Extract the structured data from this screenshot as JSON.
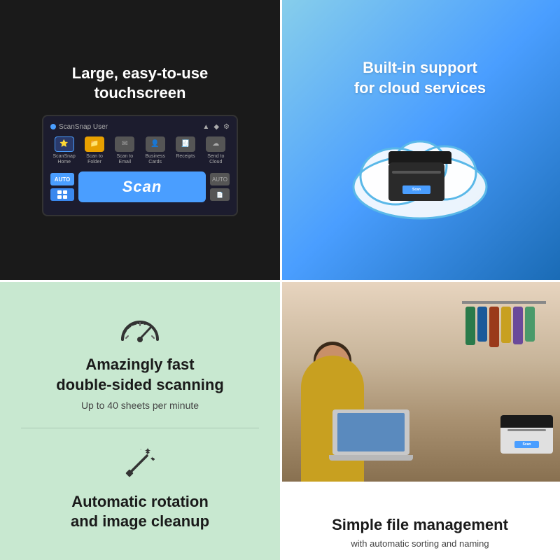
{
  "cells": {
    "top_left": {
      "title": "Large, easy-to-use\ntouchscreen",
      "screen": {
        "user_label": "ScanSnap User",
        "nav_items": [
          {
            "label": "ScanSnap\nHome",
            "icon": "⭐"
          },
          {
            "label": "Scan to\nFolder",
            "icon": "📁"
          },
          {
            "label": "Scan to\nEmail",
            "icon": "✉"
          },
          {
            "label": "Business\nCards",
            "icon": "👤"
          },
          {
            "label": "Receipts",
            "icon": "💳"
          },
          {
            "label": "Send to\nCloud",
            "icon": "☁"
          }
        ],
        "scan_button_label": "Scan",
        "auto_label": "AUTO"
      }
    },
    "top_right": {
      "title": "Built-in support\nfor cloud services",
      "scanner_scan_label": "Scan"
    },
    "bottom_left": {
      "title1": "Amazingly fast\ndouble-sided scanning",
      "subtitle1": "Up to 40 sheets per minute",
      "title2": "Automatic rotation\nand image cleanup"
    },
    "bottom_right": {
      "title": "Simple file management",
      "subtitle": "with automatic sorting and naming"
    }
  },
  "colors": {
    "accent_blue": "#4a9eff",
    "dark_bg": "#1a1a1a",
    "light_teal": "#c8e8d0",
    "sky_blue": "#87ceeb",
    "white": "#ffffff"
  }
}
